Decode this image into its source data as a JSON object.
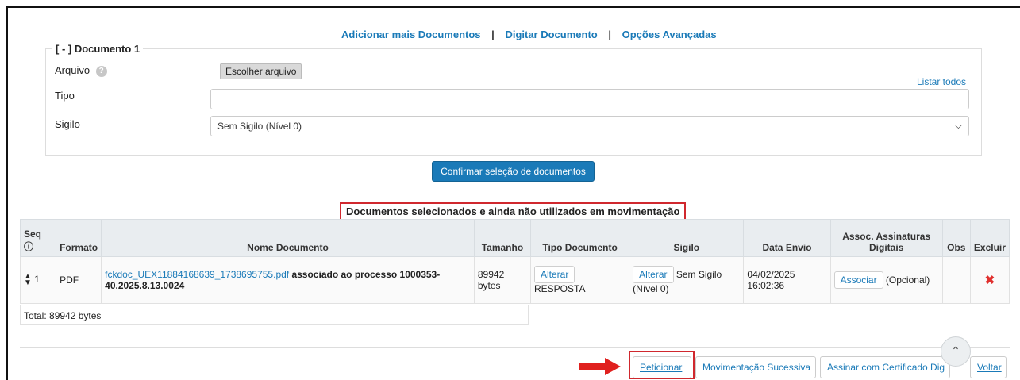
{
  "links": {
    "add_docs": "Adicionar mais Documentos",
    "type_doc": "Digitar Documento",
    "advanced": "Opções Avançadas",
    "separator": "|"
  },
  "document_form": {
    "legend": "[ - ] Documento 1",
    "arquivo_label": "Arquivo",
    "file_button": "Escolher arquivo",
    "listar_todos": "Listar todos",
    "tipo_label": "Tipo",
    "tipo_value": "",
    "sigilo_label": "Sigilo",
    "sigilo_value": "Sem Sigilo (Nível 0)"
  },
  "confirm_button": "Confirmar seleção de documentos",
  "selected_title": "Documentos selecionados e ainda não utilizados em movimentação",
  "table": {
    "headers": {
      "seq": "Seq",
      "formato": "Formato",
      "nome": "Nome Documento",
      "tamanho": "Tamanho",
      "tipo": "Tipo Documento",
      "sigilo": "Sigilo",
      "data": "Data Envio",
      "assoc": "Assoc. Assinaturas Digitais",
      "obs": "Obs",
      "excluir": "Excluir"
    },
    "row": {
      "seq": "1",
      "formato": "PDF",
      "file_link": "fckdoc_UEX11884168639_1738695755.pdf",
      "file_suffix": " associado ao processo 1000353-40.2025.8.13.0024",
      "tamanho": "89942 bytes",
      "alterar": "Alterar",
      "tipo": "RESPOSTA",
      "sigilo": "Sem Sigilo (Nível 0)",
      "data": "04/02/2025 16:02:36",
      "associar": "Associar",
      "opcional": "(Opcional)"
    },
    "total": "Total: 89942 bytes"
  },
  "bottom_buttons": {
    "peticionar": "Peticionar",
    "mov_sucessiva": "Movimentação Sucessiva",
    "assinar": "Assinar com Certificado Dig",
    "voltar": "Voltar"
  },
  "colors": {
    "link": "#1a7ab8",
    "highlight": "#d0282e",
    "primary": "#1a7ab8"
  }
}
